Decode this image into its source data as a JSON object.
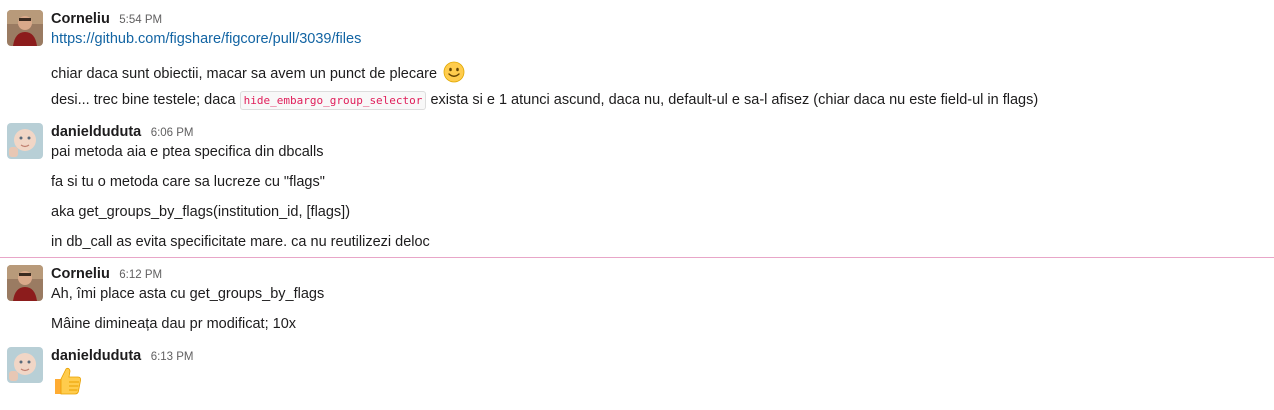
{
  "messages": [
    {
      "author": "Corneliu",
      "time": "5:54 PM",
      "lines": {
        "link": "https://github.com/figshare/figcore/pull/3039/files",
        "l2": "chiar daca sunt obiectii, macar sa avem un punct de plecare",
        "l3_pre": "desi... trec bine testele; daca",
        "l3_code": "hide_embargo_group_selector",
        "l3_post": "exista si e 1 atunci ascund, daca nu, default-ul e sa-l afisez (chiar daca nu este field-ul in flags)"
      }
    },
    {
      "author": "danielduduta",
      "time": "6:06 PM",
      "lines": {
        "l1": "pai metoda aia e ptea specifica din dbcalls",
        "l2": "fa si tu o metoda care sa lucreze cu \"flags\"",
        "l3": "aka get_groups_by_flags(institution_id, [flags])",
        "l4": "in db_call as evita specificitate mare. ca nu reutilizezi deloc"
      }
    },
    {
      "author": "Corneliu",
      "time": "6:12 PM",
      "lines": {
        "l1": "Ah, îmi place asta cu get_groups_by_flags",
        "l2": "Mâine dimineața dau pr modificat; 10x"
      }
    },
    {
      "author": "danielduduta",
      "time": "6:13 PM",
      "lines": {
        "emoji": "thumbs-up"
      }
    }
  ],
  "emojis": {
    "smile": "slightly-smiling-face",
    "thumbs": "thumbs-up"
  },
  "colors": {
    "link": "#1264a3",
    "code_text": "#e01e5a",
    "new_divider": "#e8a6c8"
  }
}
